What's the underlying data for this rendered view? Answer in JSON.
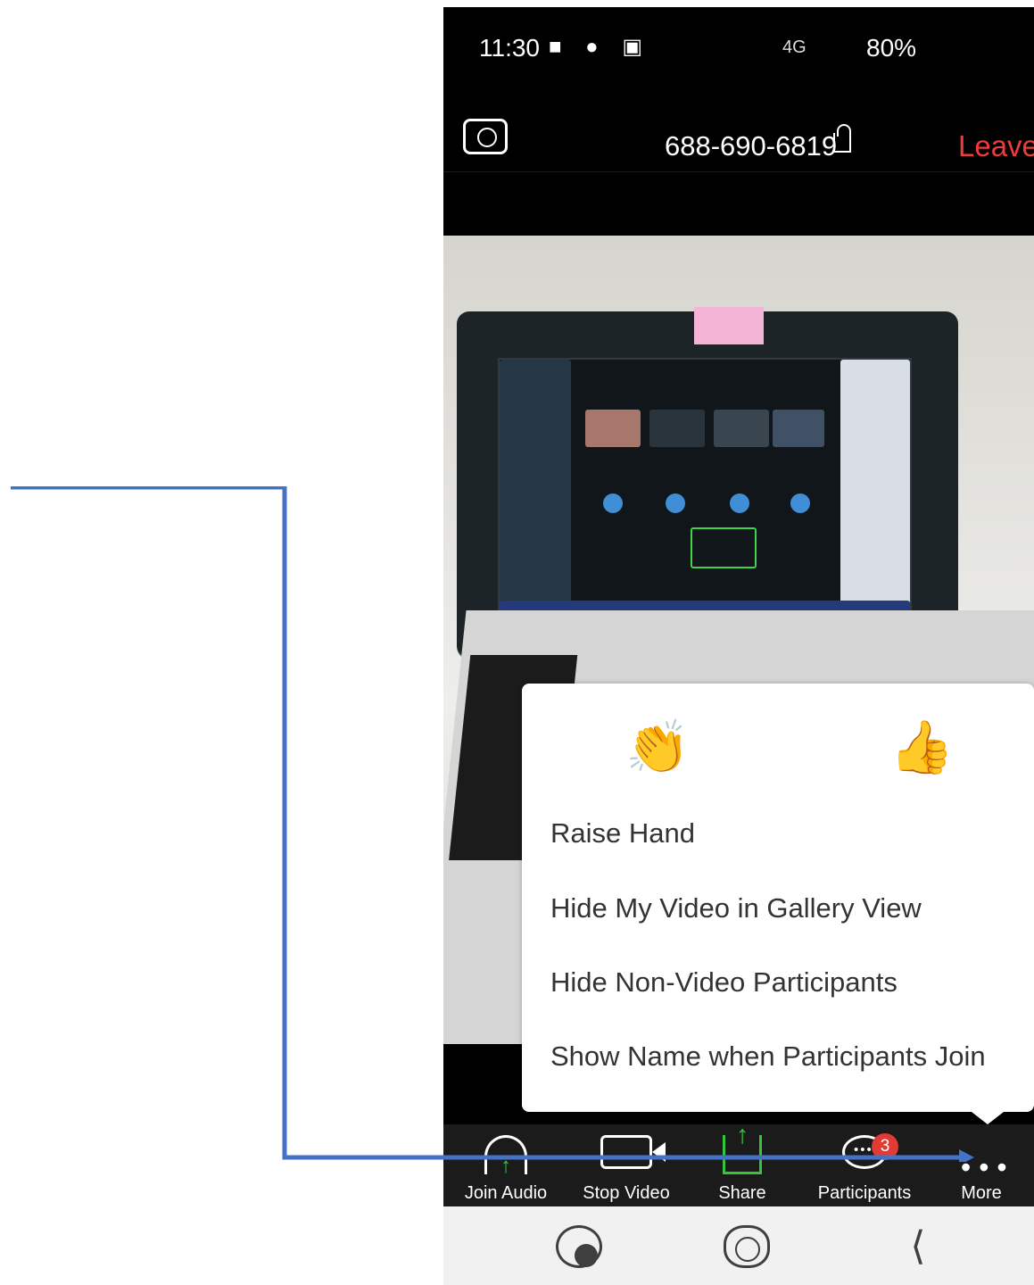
{
  "status_bar": {
    "time": "11:30",
    "left_icons": "■ ● ▣",
    "signal_text": "4G",
    "battery": "80%"
  },
  "meeting": {
    "id": "688-690-6819",
    "leave_label": "Leave"
  },
  "reactions": [
    {
      "name": "clap",
      "glyph": "👏"
    },
    {
      "name": "thumbs-up",
      "glyph": "👍"
    }
  ],
  "menu": {
    "items": [
      "Raise Hand",
      "Hide My Video in Gallery View",
      "Hide Non-Video Participants",
      "Show Name when Participants Join"
    ]
  },
  "toolbar": {
    "join_audio": "Join Audio",
    "stop_video": "Stop Video",
    "share": "Share",
    "participants": "Participants",
    "participants_badge": "3",
    "more": "More"
  },
  "navigation": {
    "back_glyph": "⟨"
  },
  "colors": {
    "leave": "#ef3b3b",
    "accent_green": "#35c53a",
    "callout": "#4472c4",
    "badge": "#e23a35"
  }
}
